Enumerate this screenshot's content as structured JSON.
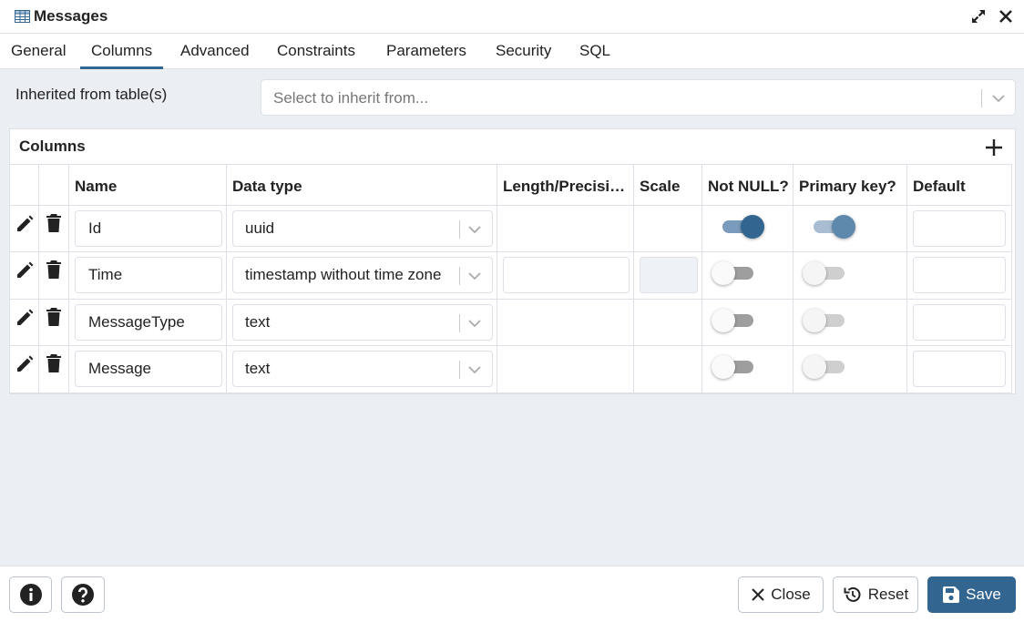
{
  "dialog": {
    "title": "Messages"
  },
  "tabs": [
    "General",
    "Columns",
    "Advanced",
    "Constraints",
    "Parameters",
    "Security",
    "SQL"
  ],
  "active_tab": "Columns",
  "inherit": {
    "label": "Inherited from table(s)",
    "placeholder": "Select to inherit from..."
  },
  "columns_panel": {
    "title": "Columns",
    "headers": [
      "Name",
      "Data type",
      "Length/Precisio…",
      "Scale",
      "Not NULL?",
      "Primary key?",
      "Default"
    ],
    "rows": [
      {
        "name": "Id",
        "data_type": "uuid",
        "not_null": true,
        "primary_key": true
      },
      {
        "name": "Time",
        "data_type": "timestamp without time zone",
        "not_null": false,
        "primary_key": false
      },
      {
        "name": "MessageType",
        "data_type": "text",
        "not_null": false,
        "primary_key": false
      },
      {
        "name": "Message",
        "data_type": "text",
        "not_null": false,
        "primary_key": false
      }
    ]
  },
  "footer": {
    "close_label": "Close",
    "reset_label": "Reset",
    "save_label": "Save"
  },
  "colors": {
    "accent": "#326690",
    "background": "#ebeef3"
  }
}
